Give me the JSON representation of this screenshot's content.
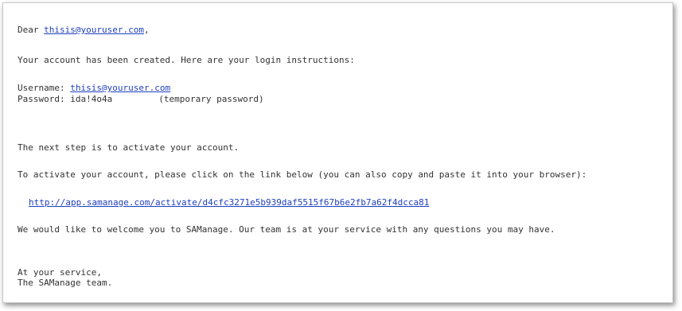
{
  "email": {
    "greeting_prefix": "Dear ",
    "greeting_email": "thisis@youruser.com",
    "greeting_suffix": ",",
    "intro": "Your account has been created. Here are your login instructions:",
    "username_label": "Username: ",
    "username_value": "thisis@youruser.com",
    "password_label": "Password: ",
    "password_value": "ida!4o4a",
    "password_note": "(temporary password)",
    "next_step": "The next step is to activate your account.",
    "activate_instructions": "To activate your account, please click on the link below (you can also copy and paste it into your browser):",
    "activation_link": "http://app.samanage.com/activate/d4cfc3271e5b939daf5515f67b6e2fb7a62f4dcca81",
    "welcome": "We would like to welcome you to SAManage. Our team is at your service with any questions you may have.",
    "signoff_1": "At your service,",
    "signoff_2": "The SAManage team."
  }
}
